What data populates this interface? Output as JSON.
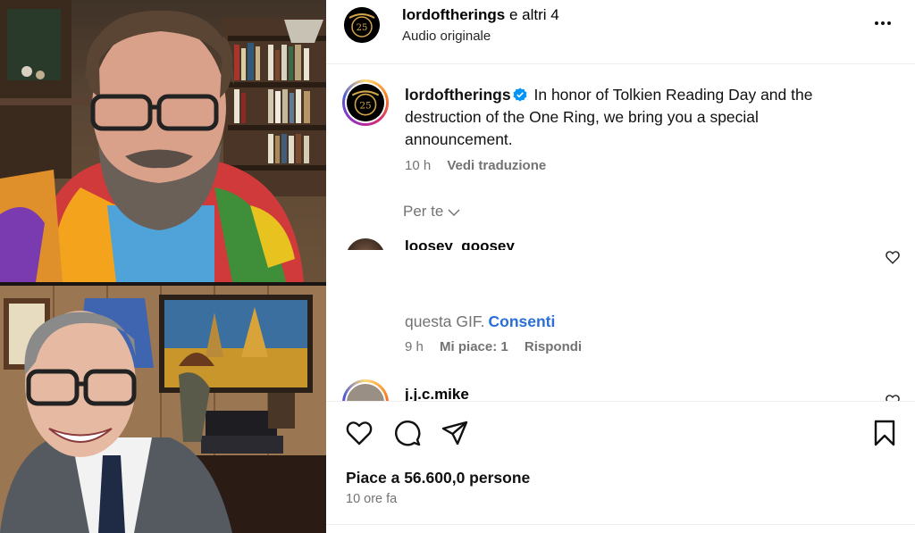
{
  "header": {
    "username": "lordoftherings",
    "others": "e altri 4",
    "audio": "Audio originale",
    "menu_icon": "more-horizontal-icon"
  },
  "caption": {
    "username": "lordoftherings",
    "verified": true,
    "text": "In honor of Tolkien Reading Day and the destruction of the One Ring, we bring you a special announcement.",
    "time": "10 h",
    "translate": "Vedi traduzione"
  },
  "filter": {
    "label": "Per te"
  },
  "comments": [
    {
      "username": "loosey_goosey",
      "text": "questa GIF.",
      "action": "Consenti",
      "time": "9 h",
      "likes": "Mi piace: 1",
      "reply": "Rispondi"
    },
    {
      "username": "j.j.c.mike"
    }
  ],
  "footer": {
    "likes": "Piace a 56.600,0 persone",
    "time": "10 ore fa"
  },
  "avatar_badge_text": "25",
  "colors": {
    "accent_blue": "#2b6fd6",
    "verified_blue": "#0095f6",
    "secondary_text": "#737373",
    "border": "#efefef",
    "story_ring": [
      "#feda75",
      "#fa7e1e",
      "#d62976",
      "#962fbf",
      "#4f5bd5"
    ]
  }
}
